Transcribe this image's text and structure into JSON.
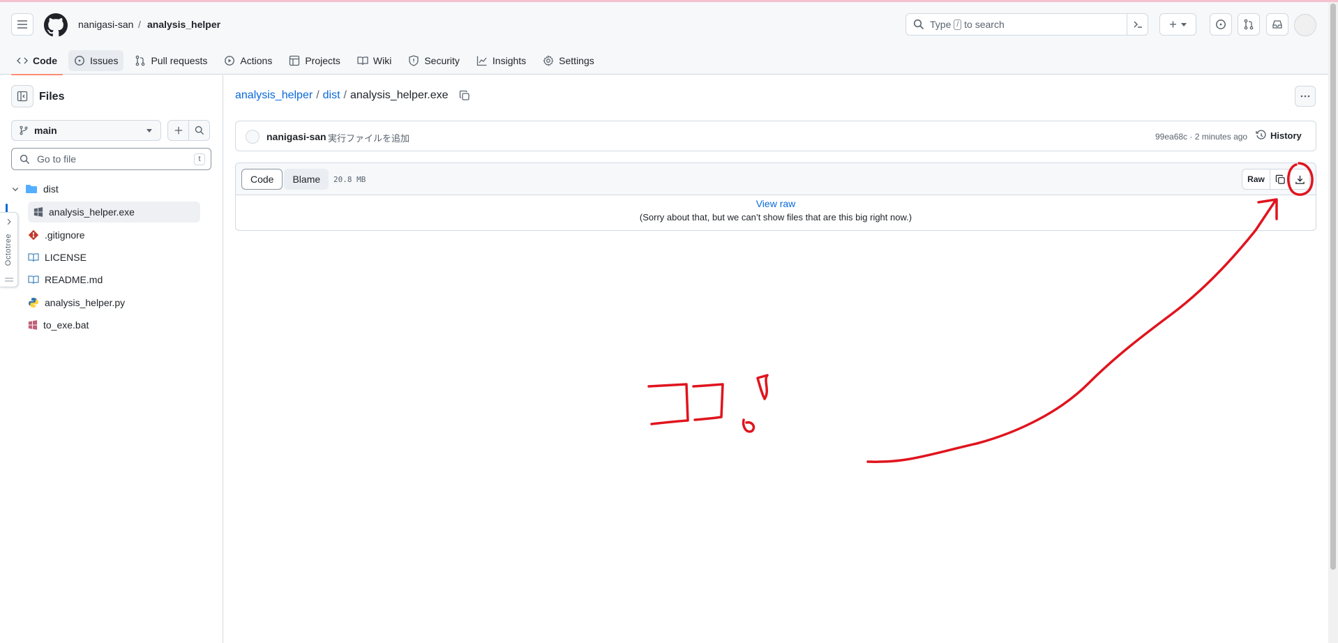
{
  "header": {
    "owner": "nanigasi-san",
    "separator": "/",
    "repo": "analysis_helper",
    "search": {
      "before": "Type",
      "key": "/",
      "after": "to search"
    },
    "plus_label": "+"
  },
  "repo_nav": {
    "tabs": [
      {
        "label": "Code",
        "icon": "code-icon"
      },
      {
        "label": "Issues",
        "icon": "issue-icon"
      },
      {
        "label": "Pull requests",
        "icon": "pull-request-icon"
      },
      {
        "label": "Actions",
        "icon": "play-icon"
      },
      {
        "label": "Projects",
        "icon": "table-icon"
      },
      {
        "label": "Wiki",
        "icon": "book-icon"
      },
      {
        "label": "Security",
        "icon": "shield-icon"
      },
      {
        "label": "Insights",
        "icon": "graph-icon"
      },
      {
        "label": "Settings",
        "icon": "gear-icon"
      }
    ]
  },
  "sidebar": {
    "title": "Files",
    "branch": "main",
    "goto_placeholder": "Go to file",
    "goto_hotkey": "t",
    "tree": [
      {
        "label": "dist",
        "icon": "folder-icon"
      },
      {
        "label": "analysis_helper.exe",
        "icon": "windows-icon"
      },
      {
        "label": ".gitignore",
        "icon": "git-icon"
      },
      {
        "label": "LICENSE",
        "icon": "book-icon"
      },
      {
        "label": "README.md",
        "icon": "book-icon"
      },
      {
        "label": "analysis_helper.py",
        "icon": "python-icon"
      },
      {
        "label": "to_exe.bat",
        "icon": "windows-icon"
      }
    ],
    "octotree_label": "Octotree"
  },
  "file_path": {
    "root": "analysis_helper",
    "dir": "dist",
    "file": "analysis_helper.exe",
    "sep": "/"
  },
  "commit": {
    "author": "nanigasi-san",
    "message": "実行ファイルを追加",
    "sha_time": "99ea68c · 2 minutes ago",
    "history_label": "History"
  },
  "file_view": {
    "code_tab": "Code",
    "blame_tab": "Blame",
    "size": "20.8 MB",
    "raw_label": "Raw",
    "view_raw": "View raw",
    "notice": "(Sorry about that, but we can’t show files that are this big right now.)"
  },
  "annotation": {
    "color": "#e0141e",
    "text": "ココ!"
  },
  "colors": {
    "link": "#0969da",
    "active_tab_underline": "#fd8c73",
    "border": "#d1d9e0"
  }
}
